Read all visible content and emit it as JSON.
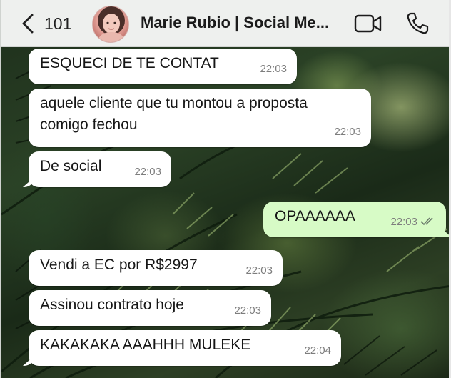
{
  "header": {
    "back_count": "101",
    "contact_name": "Marie Rubio  | Social Me..."
  },
  "messages": [
    {
      "direction": "in",
      "text": "ESQUECI DE TE CONTAT",
      "time": "22:03"
    },
    {
      "direction": "in",
      "text_line1": "aquele cliente que tu montou a proposta",
      "text_line2": "comigo fechou",
      "time": "22:03"
    },
    {
      "direction": "in",
      "text": "De social",
      "time": "22:03"
    },
    {
      "direction": "out",
      "text": "OPAAAAAA",
      "time": "22:03",
      "status": "read"
    },
    {
      "direction": "in",
      "text": "Vendi a EC por R$2997",
      "time": "22:03"
    },
    {
      "direction": "in",
      "text": "Assinou contrato hoje",
      "time": "22:03"
    },
    {
      "direction": "in",
      "text": "KAKAKAKA AAAHHH MULEKE",
      "time": "22:04"
    }
  ],
  "colors": {
    "incoming_bubble": "#ffffff",
    "outgoing_bubble": "#d7fbc6",
    "header_bg": "#eef0ee",
    "read_ticks": "#6b7a6b"
  },
  "icons": [
    "chevron-left-icon",
    "video-camera-icon",
    "phone-icon",
    "double-check-icon"
  ]
}
